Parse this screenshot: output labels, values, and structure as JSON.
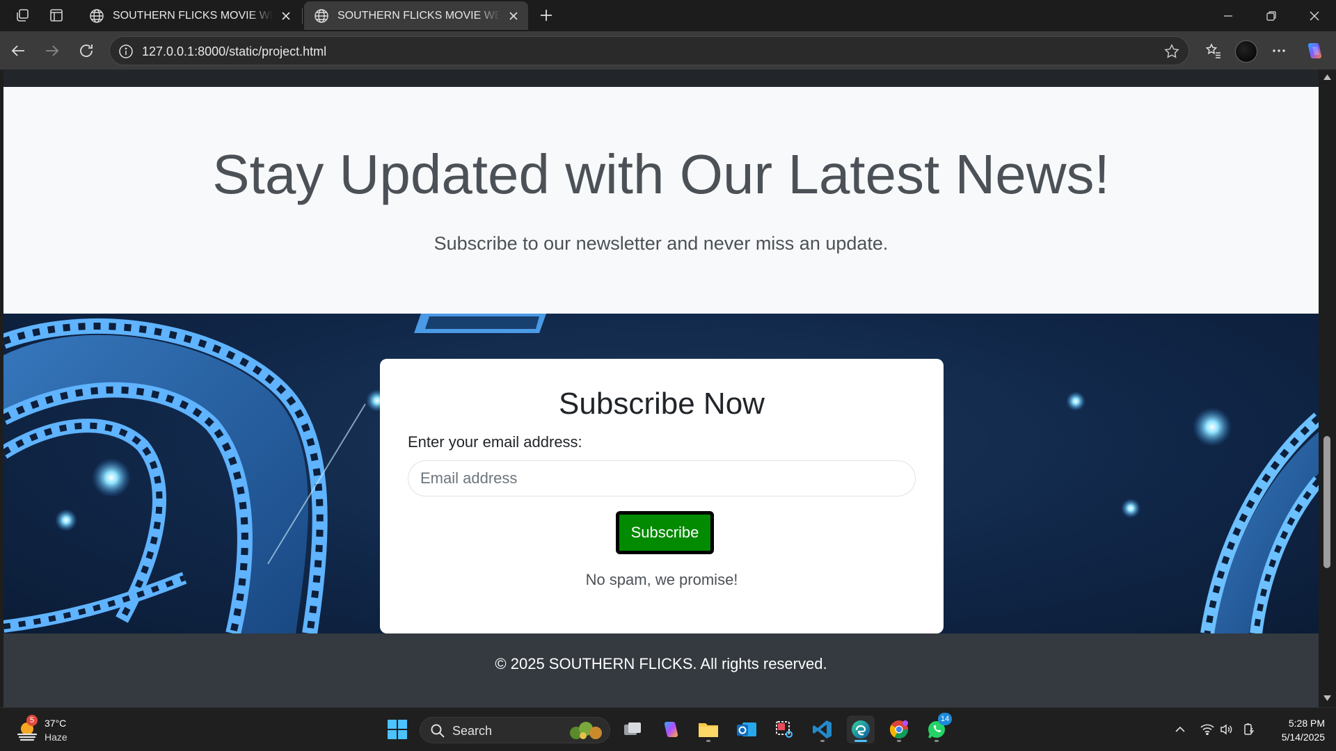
{
  "browser": {
    "tabs": [
      {
        "title": "SOUTHERN FLICKS MOVIE WEBSITE",
        "active": false
      },
      {
        "title": "SOUTHERN FLICKS MOVIE WEBSITE",
        "active": true
      }
    ],
    "url": "127.0.0.1:8000/static/project.html",
    "icons": [
      "workspaces-icon",
      "tab-actions-icon",
      "globe-icon",
      "close-icon",
      "new-tab-icon",
      "minimize-icon",
      "restore-icon",
      "window-close-icon",
      "back-icon",
      "forward-icon",
      "refresh-icon",
      "info-icon",
      "favorite-star-icon",
      "favorites-icon",
      "profile-avatar",
      "more-icon",
      "copilot-icon"
    ]
  },
  "page": {
    "hero": {
      "title": "Stay Updated with Our Latest News!",
      "subtitle": "Subscribe to our newsletter and never miss an update."
    },
    "subscribe": {
      "heading": "Subscribe Now",
      "label": "Enter your email address:",
      "email_placeholder": "Email address",
      "email_value": "",
      "button": "Subscribe",
      "note": "No spam, we promise!"
    },
    "footer": {
      "copyright": "© 2025 SOUTHERN FLICKS. All rights reserved."
    }
  },
  "taskbar": {
    "weather": {
      "temp": "37°C",
      "condition": "Haze",
      "badge": "5"
    },
    "search_label": "Search",
    "whatsapp_badge": "14",
    "time": "5:28 PM",
    "date": "5/14/2025",
    "apps": [
      "start-icon",
      "task-view-icon",
      "copilot-app-icon",
      "file-explorer-icon",
      "outlook-icon",
      "snipping-tool-icon",
      "vscode-icon",
      "edge-icon",
      "chrome-icon",
      "whatsapp-icon"
    ]
  },
  "colors": {
    "subscribe_button": "#028a00",
    "footer_bg": "#343a40",
    "hero_bg": "#f8f9fa"
  }
}
